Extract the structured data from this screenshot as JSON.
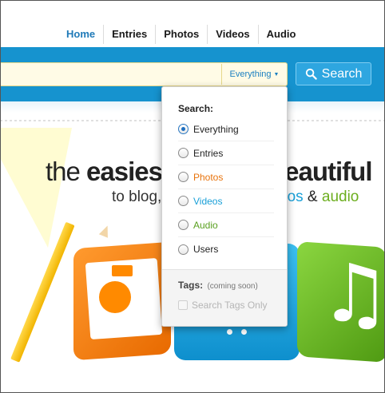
{
  "nav": {
    "items": [
      "Home",
      "Entries",
      "Photos",
      "Videos",
      "Audio"
    ],
    "active_color": "#1f7ab8"
  },
  "search": {
    "scope_label": "Everything",
    "button_label": "Search",
    "band_color": "#1693cf"
  },
  "hero": {
    "line1_left_light": "the ",
    "line1_left_bold": "easiest",
    "line1_right": "beautiful",
    "line2_left": "to blog,",
    "line2_right_videos": "eos",
    "line2_amp": " & ",
    "line2_audio": "audio",
    "colors": {
      "videos": "#1aa0d8",
      "audio": "#6cae1e"
    }
  },
  "dropdown": {
    "title": "Search:",
    "options": [
      {
        "label": "Everything",
        "selected": true,
        "color": "#222222"
      },
      {
        "label": "Entries",
        "selected": false,
        "color": "#222222"
      },
      {
        "label": "Photos",
        "selected": false,
        "color": "#e8730c"
      },
      {
        "label": "Videos",
        "selected": false,
        "color": "#1aa0d8"
      },
      {
        "label": "Audio",
        "selected": false,
        "color": "#5aa020"
      },
      {
        "label": "Users",
        "selected": false,
        "color": "#222222"
      }
    ],
    "tags_label": "Tags:",
    "tags_note": "(coming soon)",
    "tags_checkbox_label": "Search Tags Only",
    "tags_checkbox_checked": false
  }
}
